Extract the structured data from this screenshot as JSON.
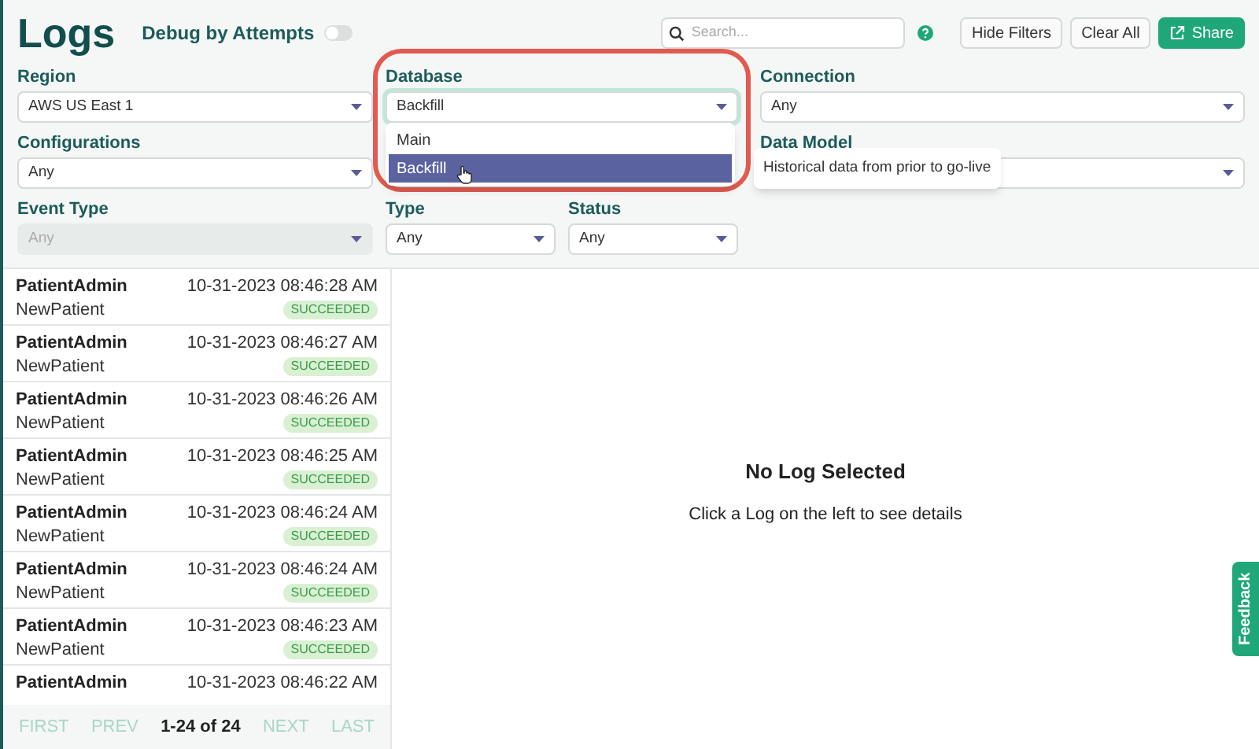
{
  "header": {
    "title": "Logs",
    "debug_toggle": {
      "label": "Debug by Attempts",
      "on": false
    },
    "search": {
      "placeholder": "Search..."
    },
    "buttons": [
      {
        "label": "Hide Filters",
        "kind": "plain"
      },
      {
        "label": "Clear All",
        "kind": "plain"
      },
      {
        "label": "Share",
        "kind": "primary"
      }
    ]
  },
  "filter_rows": [
    [
      {
        "label": "Region",
        "value": "AWS US East 1",
        "disabled": false
      },
      {
        "label": "Database",
        "value": "Backfill",
        "disabled": false,
        "expanded": true,
        "options": [
          {
            "label": "Main",
            "selected": false
          },
          {
            "label": "Backfill",
            "selected": true,
            "tooltip": "Historical data from prior to go-live"
          }
        ]
      },
      {
        "label": "Connection",
        "value": "Any",
        "disabled": false
      }
    ],
    [
      {
        "label": "Configurations",
        "value": "Any",
        "disabled": false
      },
      {
        "label": "Data Model",
        "disabled": false
      }
    ],
    [
      {
        "label": "Event Type",
        "value": "Any",
        "disabled": true
      },
      {
        "label": "Type",
        "value": "Any",
        "disabled": false
      },
      {
        "label": "Status",
        "value": "Any",
        "disabled": false
      }
    ]
  ],
  "logs": [
    {
      "name": "PatientAdmin",
      "event": "NewPatient",
      "time": "10-31-2023 08:46:28 AM",
      "status": "SUCCEEDED"
    },
    {
      "name": "PatientAdmin",
      "event": "NewPatient",
      "time": "10-31-2023 08:46:27 AM",
      "status": "SUCCEEDED"
    },
    {
      "name": "PatientAdmin",
      "event": "NewPatient",
      "time": "10-31-2023 08:46:26 AM",
      "status": "SUCCEEDED"
    },
    {
      "name": "PatientAdmin",
      "event": "NewPatient",
      "time": "10-31-2023 08:46:25 AM",
      "status": "SUCCEEDED"
    },
    {
      "name": "PatientAdmin",
      "event": "NewPatient",
      "time": "10-31-2023 08:46:24 AM",
      "status": "SUCCEEDED"
    },
    {
      "name": "PatientAdmin",
      "event": "NewPatient",
      "time": "10-31-2023 08:46:24 AM",
      "status": "SUCCEEDED"
    },
    {
      "name": "PatientAdmin",
      "event": "NewPatient",
      "time": "10-31-2023 08:46:23 AM",
      "status": "SUCCEEDED"
    },
    {
      "name": "PatientAdmin",
      "time": "10-31-2023 08:46:22 AM"
    }
  ],
  "pagination": {
    "first": "FIRST",
    "prev": "PREV",
    "range": "1-24 of 24",
    "next": "NEXT",
    "last": "LAST"
  },
  "detail": {
    "title": "No Log Selected",
    "hint": "Click a Log on the left to see details"
  },
  "feedback": "Feedback"
}
